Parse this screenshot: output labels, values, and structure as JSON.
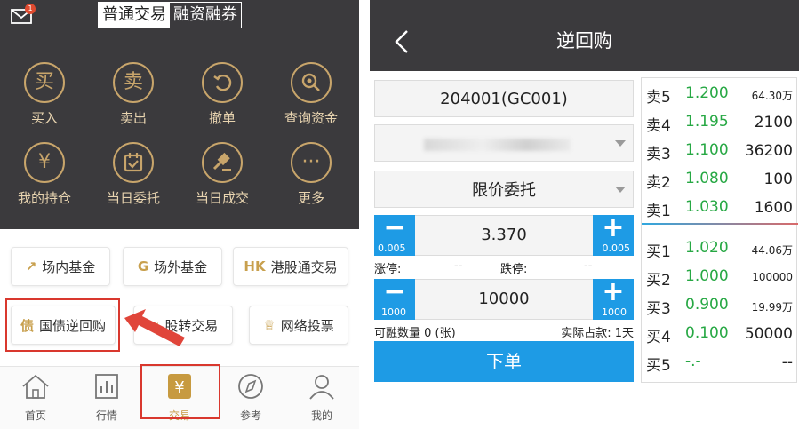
{
  "left": {
    "header": {
      "badge": "1",
      "tab_normal": "普通交易",
      "tab_margin": "融资融券"
    },
    "actions": [
      {
        "label": "买入",
        "icon_text": "买",
        "icon": "buy-icon"
      },
      {
        "label": "卖出",
        "icon_text": "卖",
        "icon": "sell-icon"
      },
      {
        "label": "撤单",
        "icon_text": "↶",
        "icon": "undo-icon"
      },
      {
        "label": "查询资金",
        "icon_text": "",
        "icon": "search-funds-icon"
      },
      {
        "label": "我的持仓",
        "icon_text": "¥",
        "icon": "holdings-icon"
      },
      {
        "label": "当日委托",
        "icon_text": "",
        "icon": "calendar-check-icon"
      },
      {
        "label": "当日成交",
        "icon_text": "",
        "icon": "gavel-icon"
      },
      {
        "label": "更多",
        "icon_text": "···",
        "icon": "more-icon"
      }
    ],
    "services": [
      {
        "label": "场内基金",
        "ic": "↗"
      },
      {
        "label": "场外基金",
        "ic": "G"
      },
      {
        "label": "港股通交易",
        "ic": "HK"
      },
      {
        "label": "国债逆回购",
        "ic": "债"
      },
      {
        "label": "股转交易",
        "ic": "≈"
      },
      {
        "label": "网络投票",
        "ic": "♕"
      }
    ],
    "tabs": [
      {
        "label": "首页",
        "icon": "home-icon"
      },
      {
        "label": "行情",
        "icon": "market-icon"
      },
      {
        "label": "交易",
        "icon": "trade-icon"
      },
      {
        "label": "参考",
        "icon": "compass-icon"
      },
      {
        "label": "我的",
        "icon": "profile-icon"
      }
    ],
    "active_tab": "交易"
  },
  "right": {
    "title": "逆回购",
    "code": "204001(GC001)",
    "order_type": "限价委托",
    "price": {
      "value": "3.370",
      "step": "0.005"
    },
    "limit_up_label": "涨停:",
    "limit_up_value": "--",
    "limit_down_label": "跌停:",
    "limit_down_value": "--",
    "quantity": {
      "value": "10000",
      "step": "1000"
    },
    "available": "可融数量 0 (张)",
    "actual_days": "实际占款: 1天",
    "submit": "下单",
    "asks": [
      {
        "name": "卖5",
        "price": "1.200",
        "qty": "64.30万"
      },
      {
        "name": "卖4",
        "price": "1.195",
        "qty": "2100"
      },
      {
        "name": "卖3",
        "price": "1.100",
        "qty": "36200"
      },
      {
        "name": "卖2",
        "price": "1.080",
        "qty": "100"
      },
      {
        "name": "卖1",
        "price": "1.030",
        "qty": "1600"
      }
    ],
    "bids": [
      {
        "name": "买1",
        "price": "1.020",
        "qty": "44.06万"
      },
      {
        "name": "买2",
        "price": "1.000",
        "qty": "100000"
      },
      {
        "name": "买3",
        "price": "0.900",
        "qty": "19.99万"
      },
      {
        "name": "买4",
        "price": "0.100",
        "qty": "50000"
      },
      {
        "name": "买5",
        "price": "-.-",
        "qty": "--"
      }
    ]
  },
  "colors": {
    "accent_gold": "#c8a56b",
    "dark_bg": "#3b3a3d",
    "blue": "#1e9be5",
    "green": "#27a844",
    "highlight_red": "#d9382e"
  }
}
